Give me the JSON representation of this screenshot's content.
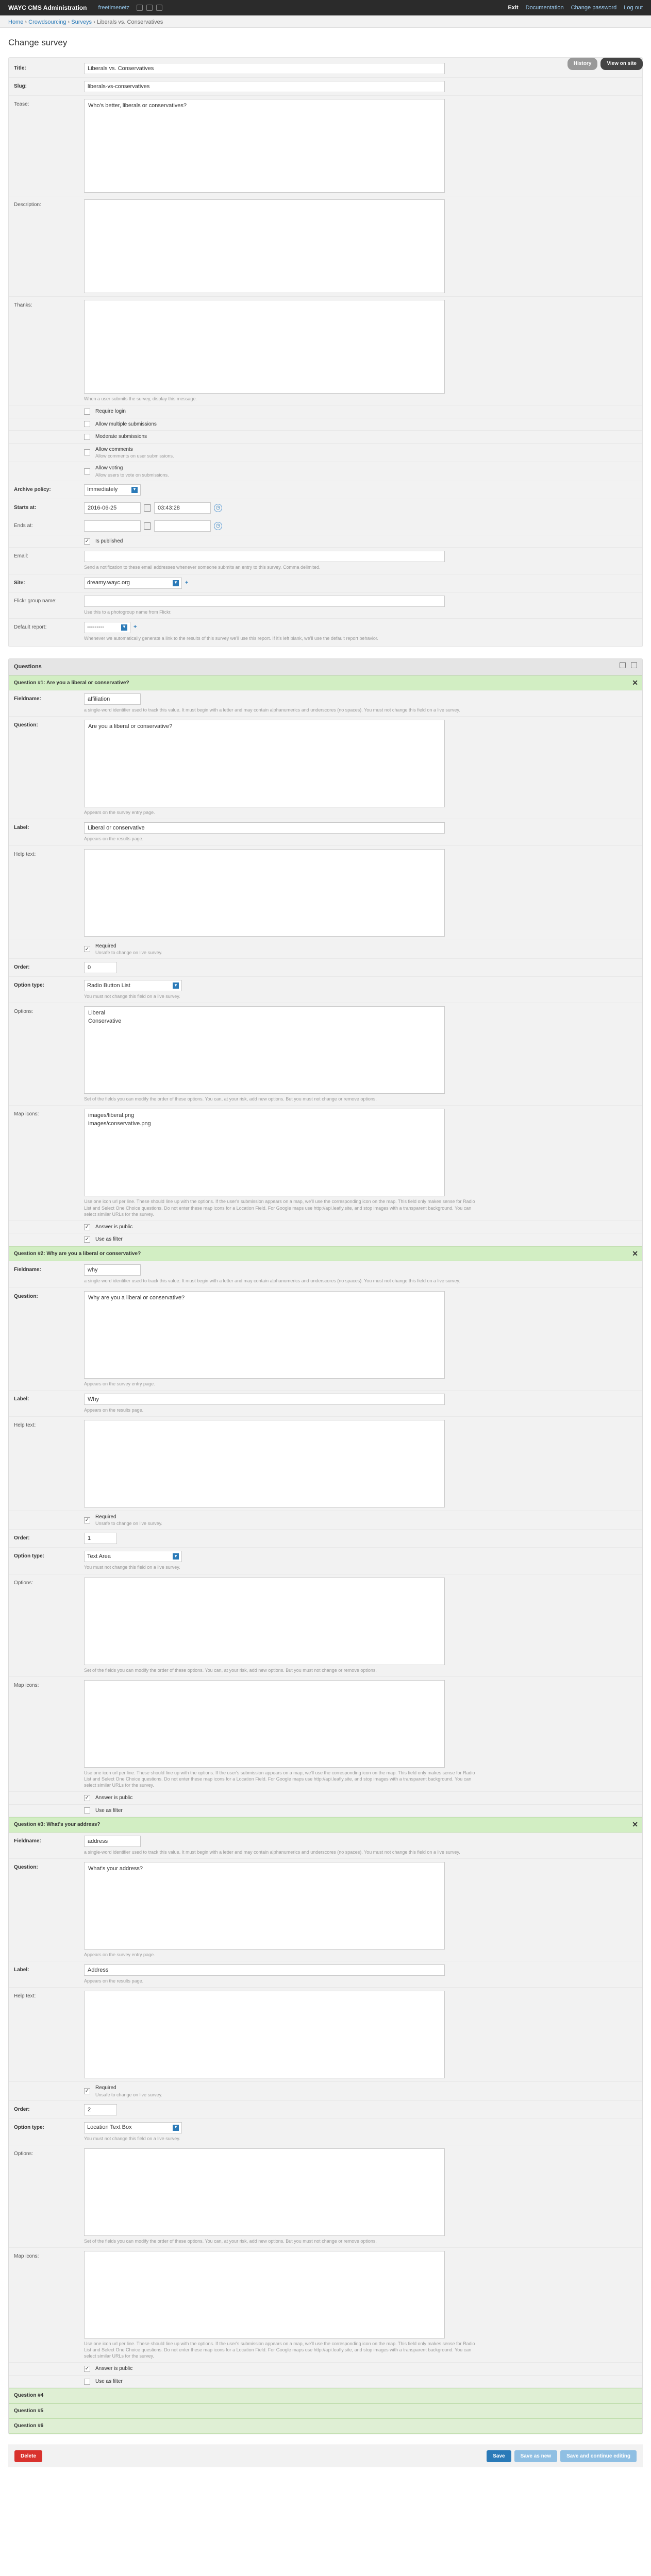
{
  "header": {
    "brand": "WAYC CMS Administration",
    "site": "freetimenetz",
    "links": [
      "Exit",
      "Documentation",
      "Change password",
      "Log out"
    ]
  },
  "breadcrumbs": [
    "Home",
    "Crowdsourcing",
    "Surveys",
    "Liberals vs. Conservatives"
  ],
  "page": {
    "title": "Change survey",
    "history_label": "History",
    "view_on_site_label": "View on site"
  },
  "survey": {
    "title_label": "Title:",
    "title_value": "Liberals vs. Conservatives",
    "slug_label": "Slug:",
    "slug_value": "liberals-vs-conservatives",
    "tease_label": "Tease:",
    "tease_value": "Who's better, liberals or conservatives?",
    "description_label": "Description:",
    "thanks_label": "Thanks:",
    "thanks_help": "When a user submits the survey, display this message.",
    "require_login": "Require login",
    "allow_multiple": "Allow multiple submissions",
    "moderate": "Moderate submissions",
    "allow_comments": "Allow comments",
    "allow_comments_help": "Allow comments on user submissions.",
    "allow_voting": "Allow voting",
    "allow_voting_help": "Allow users to vote on submissions.",
    "archive_label": "Archive policy:",
    "archive_value": "Immediately",
    "starts_label": "Starts at:",
    "starts_date": "2016-06-25",
    "starts_time": "03:43:28",
    "ends_label": "Ends at:",
    "published": "Is published",
    "email_label": "Email:",
    "email_help": "Send a notification to these email addresses whenever someone submits an entry to this survey. Comma delimited.",
    "site_label": "Site:",
    "site_value": "dreamy.wayc.org",
    "flickr_label": "Flickr group name:",
    "flickr_help": "Use this to a photogroup name from Flickr.",
    "default_report_label": "Default report:",
    "default_report_value": "---------",
    "default_report_help": "Whenever we automatically generate a link to the results of this survey we'll use this report. If it's left blank, we'll use the default report behavior."
  },
  "questions": {
    "group_title": "Questions",
    "fieldname_help": "a single-word identifier used to track this value. It must begin with a letter and may contain alphanumerics and underscores (no spaces). You must not change this field on a live survey.",
    "question_help": "Appears on the survey entry page.",
    "label_help": "Appears on the results page.",
    "required_help": "Unsafe to change on live survey.",
    "option_type_help": "You must not change this field on a live survey.",
    "options_help": "Set of the fields you can modify the order of these options. You can, at your risk, add new options. But you must not change or remove options.",
    "map_icons_help": "Use one icon url per line. These should line up with the options. If the user's submission appears on a map, we'll use the corresponding icon on the map. This field only makes sense for Radio List and Select One Choice questions. Do not enter these map icons for a Location Field. For Google maps use http://api.leafly.site, and stop images with a transparent background. You can select similar URLs for the survey.",
    "items": [
      {
        "header": "Question #1: Are you a liberal or conservative?",
        "fieldname": "affiliation",
        "question": "Are you a liberal or conservative?",
        "label": "Liberal or conservative",
        "order": "0",
        "option_type": "Radio Button List",
        "options": "Liberal\nConservative",
        "map_icons": "images/liberal.png\nimages/conservative.png",
        "answer_is_public": "Answer is public",
        "use_as_filter": "Use as filter"
      },
      {
        "header": "Question #2: Why are you a liberal or conservative?",
        "fieldname": "why",
        "question": "Why are you a liberal or conservative?",
        "label": "Why",
        "order": "1",
        "option_type": "Text Area",
        "options": "",
        "map_icons": "",
        "answer_is_public": "Answer is public",
        "use_as_filter": "Use as filter"
      },
      {
        "header": "Question #3: What's your address?",
        "fieldname": "address",
        "question": "What's your address?",
        "label": "Address",
        "order": "2",
        "option_type": "Location Text Box",
        "options": "",
        "map_icons": "",
        "answer_is_public": "Answer is public",
        "use_as_filter": "Use as filter"
      }
    ],
    "labels": {
      "fieldname": "Fieldname:",
      "question": "Question:",
      "label": "Label:",
      "help_text": "Help text:",
      "required": "Required",
      "order": "Order:",
      "option_type": "Option type:",
      "options": "Options:",
      "map_icons": "Map icons:"
    },
    "collapsed": [
      "Question #4",
      "Question #5",
      "Question #6"
    ]
  },
  "submit": {
    "delete": "Delete",
    "save": "Save",
    "save_as_new": "Save as new",
    "save_continue": "Save and continue editing"
  }
}
